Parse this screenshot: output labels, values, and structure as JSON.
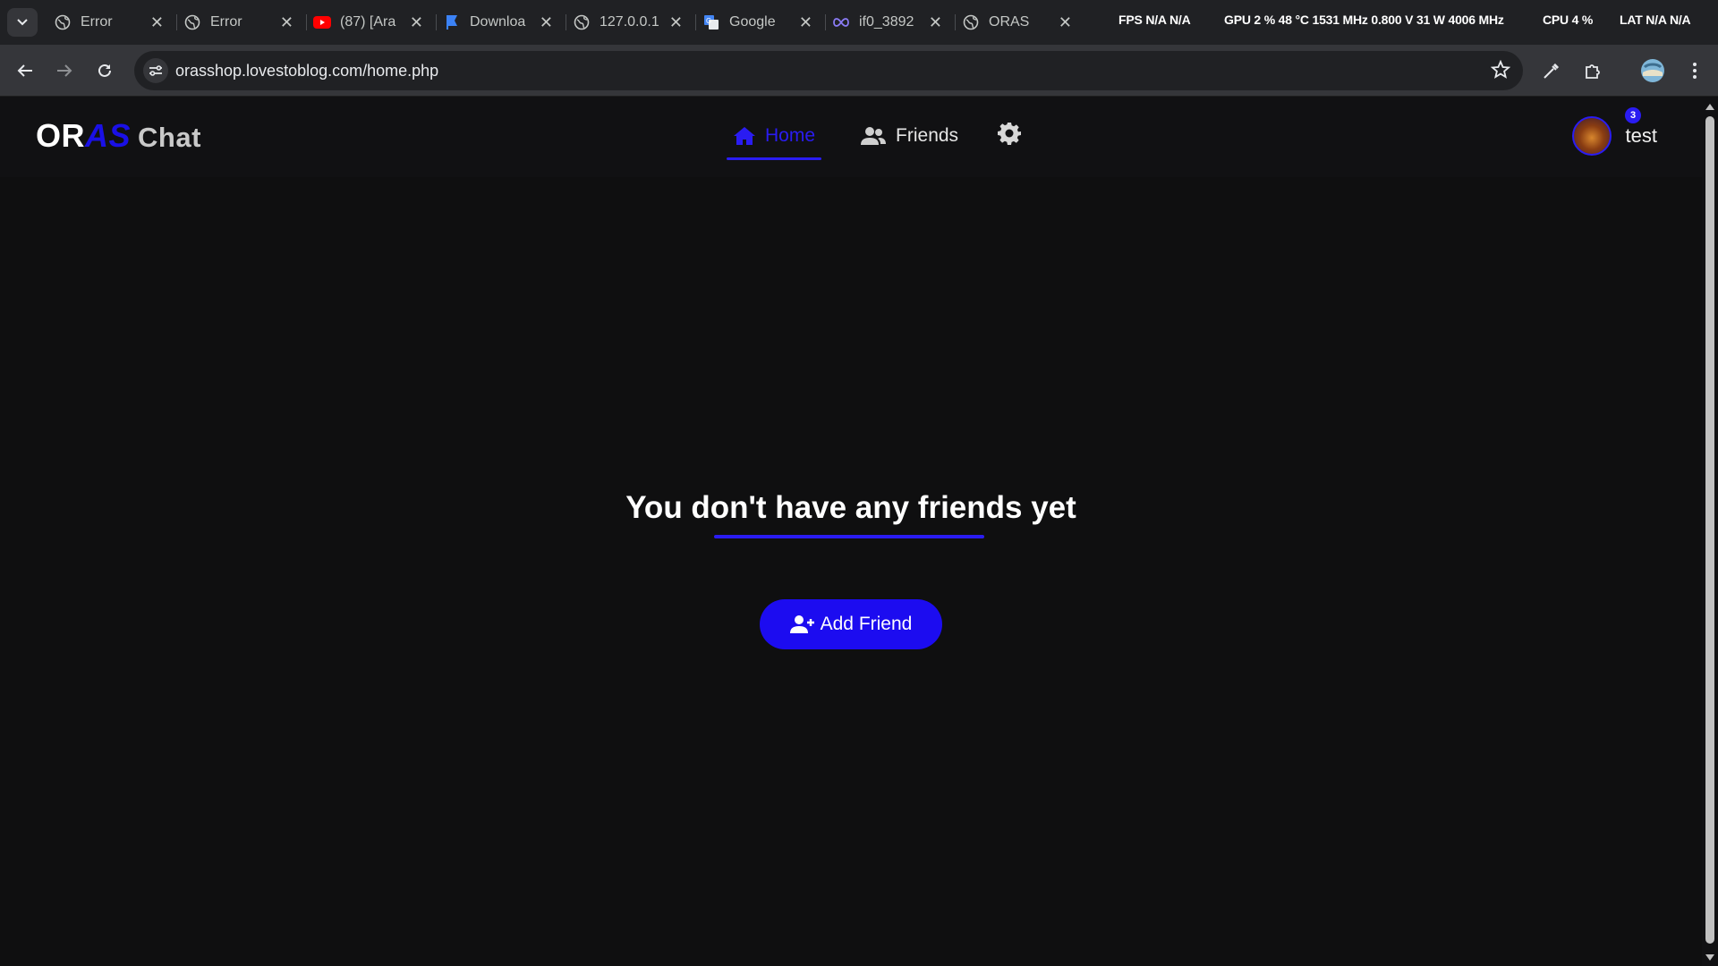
{
  "browser": {
    "tabs": [
      {
        "title": "Error",
        "icon": "globe-icon"
      },
      {
        "title": "Error",
        "icon": "globe-icon"
      },
      {
        "title": "(87) [Ara",
        "icon": "youtube-icon"
      },
      {
        "title": "Downloa",
        "icon": "download-flag-icon"
      },
      {
        "title": "127.0.0.1",
        "icon": "globe-icon"
      },
      {
        "title": "Google",
        "icon": "google-translate-icon"
      },
      {
        "title": "if0_3892",
        "icon": "infinity-icon"
      },
      {
        "title": "ORAS",
        "icon": "globe-icon"
      }
    ],
    "overlay": {
      "fps": "FPS  N/A  N/A",
      "gpu": "GPU  2 %  48 °C  1531 MHz  0.800 V  31 W  4006 MHz",
      "cpu": "CPU  4 %",
      "lat": "LAT  N/A  N/A"
    },
    "url": "orasshop.lovestoblog.com/home.php"
  },
  "site": {
    "logo": {
      "part1": "OR",
      "part2": "AS",
      "part3": "Chat"
    },
    "nav": {
      "home": "Home",
      "friends": "Friends"
    },
    "user": {
      "name": "test",
      "notifications": "3"
    }
  },
  "main": {
    "empty_message": "You don't have any friends yet",
    "add_friend_label": "Add Friend"
  },
  "colors": {
    "accent": "#1c0cf0",
    "background": "#0f0f10"
  }
}
